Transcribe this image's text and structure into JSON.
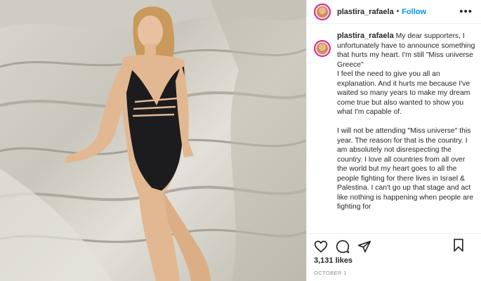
{
  "post": {
    "username": "plastira_rafaela",
    "follow_label": "Follow",
    "separator": "•",
    "more_label": "•••"
  },
  "caption": {
    "username": "plastira_rafaela",
    "paragraph1": "My dear supporters, I unfortunately have to announce something that hurts my heart. I'm still \"Miss universe Greece\"",
    "paragraph2": "I feel the need to give you all an explanation. And it hurts me because I've waited so many years to make my dream come true but also wanted to show you what I'm capable of.",
    "paragraph3": "I will not be attending \"Miss universe\" this year. The reason for that is the country. I am absolutely not disrespecting the country. I love all countries from all over the world but my heart goes to all the people fighting for there lives in Israel & Palestina. I can't go up that stage and act like nothing is happening when people are fighting for"
  },
  "actions": {
    "like_icon": "heart-icon",
    "comment_icon": "comment-icon",
    "share_icon": "send-icon",
    "save_icon": "bookmark-icon"
  },
  "stats": {
    "likes": "3,131 likes",
    "date": "OCTOBER 1"
  },
  "colors": {
    "follow": "#0095f6",
    "text": "#262626",
    "muted": "#8e8e8e",
    "avatar_ring": "#d6249f"
  }
}
